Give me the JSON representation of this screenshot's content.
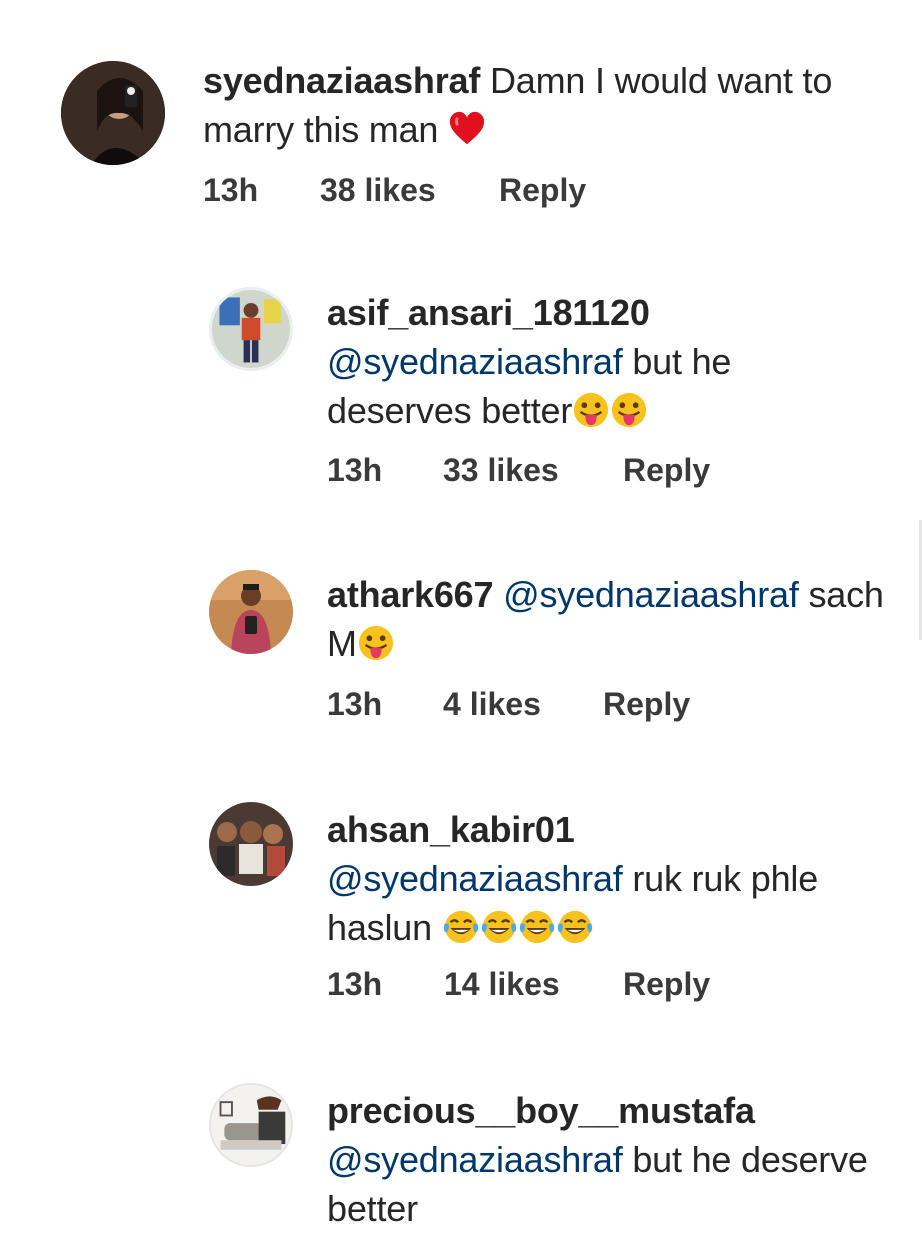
{
  "comments": [
    {
      "username": "syednaziaashraf",
      "text": "Damn I would want to marry this man",
      "emoji": "red-heart",
      "time": "13h",
      "likes": "38 likes",
      "reply": "Reply"
    },
    {
      "username": "asif_ansari_181120",
      "mention": "@syednaziaashraf",
      "text": "but he deserves better",
      "emoji": "tongue-face x2",
      "time": "13h",
      "likes": "33 likes",
      "reply": "Reply"
    },
    {
      "username": "athark667",
      "mention": "@syednaziaashraf",
      "text": "sach M",
      "emoji": "tongue-face",
      "time": "13h",
      "likes": "4 likes",
      "reply": "Reply"
    },
    {
      "username": "ahsan_kabir01",
      "mention": "@syednaziaashraf",
      "text": "ruk ruk phle haslun",
      "emoji": "tears-of-joy x4",
      "time": "13h",
      "likes": "14 likes",
      "reply": "Reply"
    },
    {
      "username": "precious__boy__mustafa",
      "mention": "@syednaziaashraf",
      "text": "but he deserve better"
    }
  ],
  "colors": {
    "text": "#262626",
    "mention": "#00376b",
    "meta": "#3a3a3a"
  }
}
